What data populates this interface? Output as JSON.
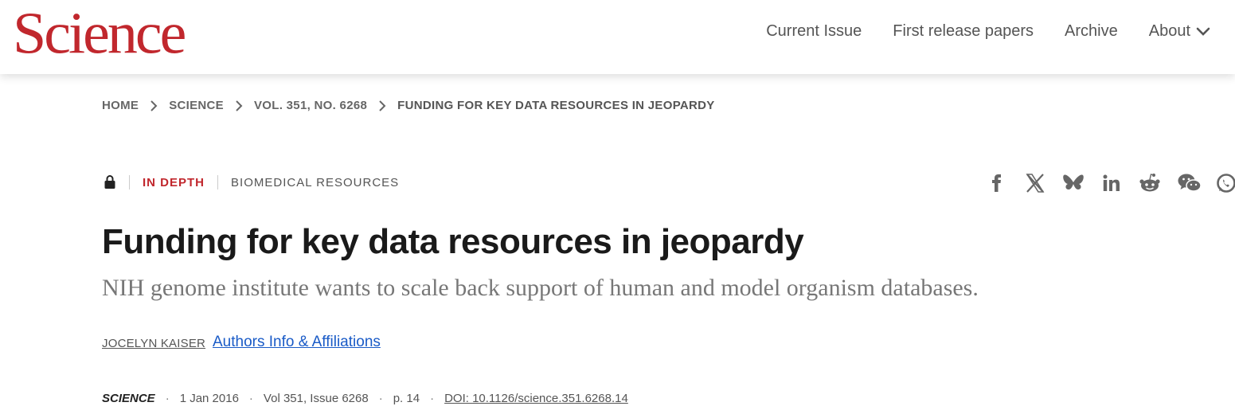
{
  "header": {
    "logo": "Science",
    "nav": [
      {
        "label": "Current Issue"
      },
      {
        "label": "First release papers"
      },
      {
        "label": "Archive"
      },
      {
        "label": "About"
      }
    ]
  },
  "breadcrumb": [
    "HOME",
    "SCIENCE",
    "VOL. 351, NO. 6268",
    "FUNDING FOR KEY DATA RESOURCES IN JEOPARDY"
  ],
  "article": {
    "access_icon": "lock-icon",
    "kicker": "IN DEPTH",
    "section": "BIOMEDICAL RESOURCES",
    "title": "Funding for key data resources in jeopardy",
    "subtitle": "NIH genome institute wants to scale back support of human and model organism databases.",
    "author": "JOCELYN KAISER",
    "affiliations_link": "Authors Info & Affiliations",
    "citation": {
      "journal": "SCIENCE",
      "date": "1 Jan 2016",
      "volume_issue": "Vol 351, Issue 6268",
      "page": "p. 14",
      "doi": "DOI: 10.1126/science.351.6268.14"
    }
  },
  "share_icons": [
    "facebook-icon",
    "x-icon",
    "bluesky-icon",
    "linkedin-icon",
    "reddit-icon",
    "wechat-icon",
    "whatsapp-icon"
  ],
  "colors": {
    "brand": "#c1272d",
    "link": "#1a5bc7"
  }
}
